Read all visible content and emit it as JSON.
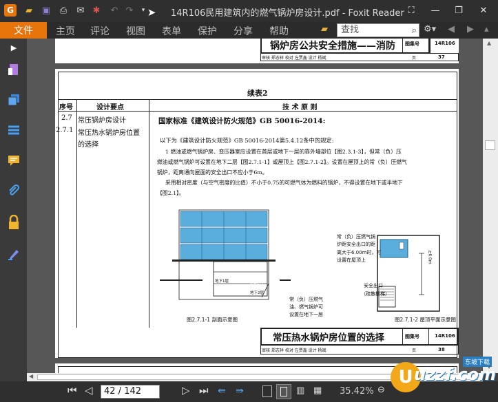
{
  "titlebar": {
    "title": "14R106民用建筑内的燃气锅炉房设计.pdf - Foxit Reader",
    "app_icon_letter": "G"
  },
  "menubar": {
    "file": "文件",
    "items": [
      "主页",
      "评论",
      "视图",
      "表单",
      "保护",
      "分享",
      "帮助"
    ],
    "search_placeholder": "查找"
  },
  "page_top": {
    "title": "锅炉房公共安全措施——消防",
    "atlas_label": "图集号",
    "atlas_no": "14R106",
    "review_row": "审核 郑志祥 校对 左贾鑫 设计 杨斌",
    "page_label": "页",
    "page_no": "37"
  },
  "page_main": {
    "table_title": "续表2",
    "col_seq": "序号",
    "col_design": "设计要点",
    "col_principle": "技 术 原 则",
    "seq_1": "2.7",
    "seq_2": "2.7.1",
    "design_1": "常压锅炉房设计",
    "design_2": "常压热水锅炉房位置",
    "design_3": "的选择",
    "standard": "国家标准《建筑设计防火规范》GB 50016-2014:",
    "para1": "以下为《建筑设计防火规范》GB 50016-2014第5.4.12条中的规定:",
    "para2a": "1 燃油或燃气锅炉房、变压器室应设置在首层或地下一层的靠外墙部位【图2.3.1-3】，但常（负）压",
    "para2b": "燃油或燃气锅炉可设置在地下二层【图2.7.1-1】或屋顶上【图2.7.1-2】。设置在屋顶上的常（负）压燃气",
    "para2c": "锅炉，距离通向屋面的安全出口不应小于6m。",
    "para3a": "采用相对密度（与空气密度的比值）不小于0.75的可燃气体为燃料的锅炉，不得设置在地下或半地下",
    "para3b": "【图2.1】。",
    "fig1_labels": [
      "地下2层",
      "地下3层",
      "首层",
      "地下1层",
      "地下2层"
    ],
    "fig1_note": "常（负）压燃气",
    "fig1_note2": "油、燃气锅炉可",
    "fig1_note3": "设置在地下一层",
    "fig1_caption": "图2.7.1-1  剖面示意图",
    "fig2_note1": "常（负）压燃气锅",
    "fig2_note2": "炉距安全出口的距",
    "fig2_note3": "离大于6.00m时，可",
    "fig2_note4": "设置在屋顶上",
    "fig2_exit1": "安全出口",
    "fig2_exit2": "（疏散楼梯）",
    "fig2_dim": "≥6.0m",
    "fig2_caption": "图2.7.1-2  屋顶平面示意图",
    "note1": "注：1.规范对常压锅炉房设置在屋顶上有如下说明：对于常（负）压燃气锅炉房设置在屋顶间距，经过大量的调研和对常（负）压锅炉房实",
    "note2": "际运行情况的考察，在燃料供给等有相应防火措施的情况下可设置在屋顶，但锅炉房的门离安全出口的距离应大于6.00m。",
    "bottom_title": "常压热水锅炉房位置的选择",
    "atlas_label": "图集号",
    "atlas_no": "14R106",
    "review_row": "审核 郑志祥 校对 左贾鑫 设计 杨斌",
    "page_label": "页",
    "page_no": "38"
  },
  "statusbar": {
    "page_input": "42 / 142",
    "zoom": "35.42%"
  },
  "watermark": {
    "text": "uzzf.com",
    "sub": "东坡下载"
  },
  "colors": {
    "accent": "#e8740c",
    "titlebar": "#2f2f2f",
    "doc_bg": "#575757",
    "fig_blue": "#5aaedd"
  }
}
